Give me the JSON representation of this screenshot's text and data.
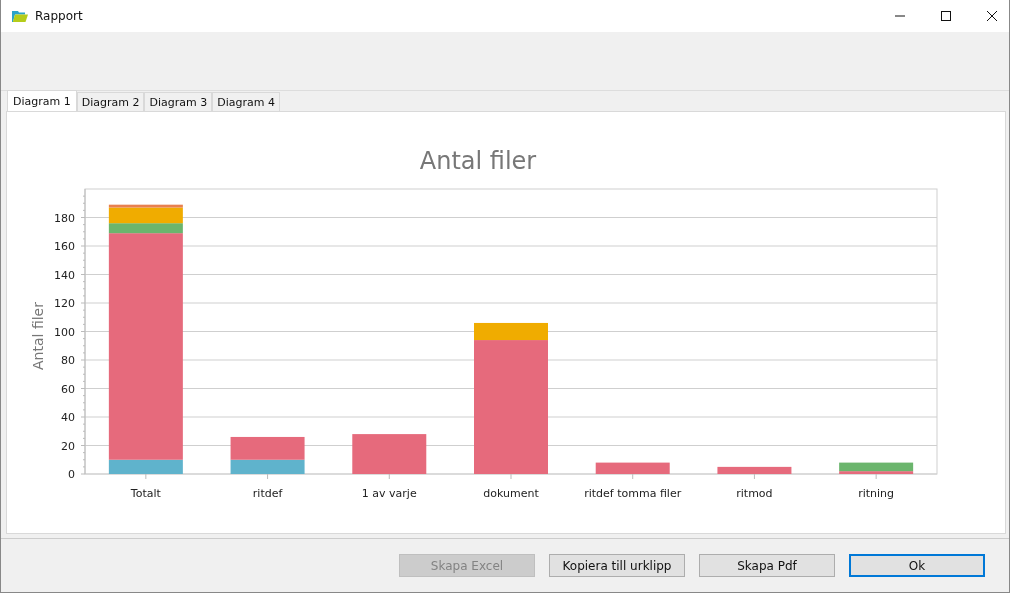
{
  "window": {
    "title": "Rapport"
  },
  "tabs": [
    {
      "label": "Diagram 1",
      "selected": true
    },
    {
      "label": "Diagram 2",
      "selected": false
    },
    {
      "label": "Diagram 3",
      "selected": false
    },
    {
      "label": "Diagram 4",
      "selected": false
    }
  ],
  "chart": {
    "chart_data": {
      "type": "bar",
      "stacked": true,
      "title": "Antal filer",
      "ylabel": "Antal filer",
      "categories": [
        "Totalt",
        "ritdef",
        "1 av varje",
        "dokument",
        "ritdef tomma filer",
        "ritmod",
        "ritning"
      ],
      "series": [
        {
          "color": "#5fb3cc",
          "values": [
            10,
            10,
            0,
            0,
            0,
            0,
            0
          ]
        },
        {
          "color": "#e66a7c",
          "values": [
            159,
            16,
            28,
            94,
            8,
            5,
            2
          ]
        },
        {
          "color": "#6bb56d",
          "values": [
            7,
            0,
            0,
            0,
            0,
            0,
            6
          ]
        },
        {
          "color": "#f0ac00",
          "values": [
            11,
            0,
            0,
            12,
            0,
            0,
            0
          ]
        },
        {
          "color": "#e8804f",
          "values": [
            2,
            0,
            0,
            0,
            0,
            0,
            0
          ]
        }
      ],
      "ylim": [
        0,
        200
      ],
      "grid": true,
      "yticks": [
        0,
        20,
        40,
        60,
        80,
        100,
        120,
        140,
        160,
        180
      ]
    }
  },
  "buttons": [
    {
      "label": "Skapa Excel",
      "disabled": true,
      "default": false
    },
    {
      "label": "Kopiera till urklipp",
      "disabled": false,
      "default": false
    },
    {
      "label": "Skapa Pdf",
      "disabled": false,
      "default": false
    },
    {
      "label": "Ok",
      "disabled": false,
      "default": true
    }
  ]
}
